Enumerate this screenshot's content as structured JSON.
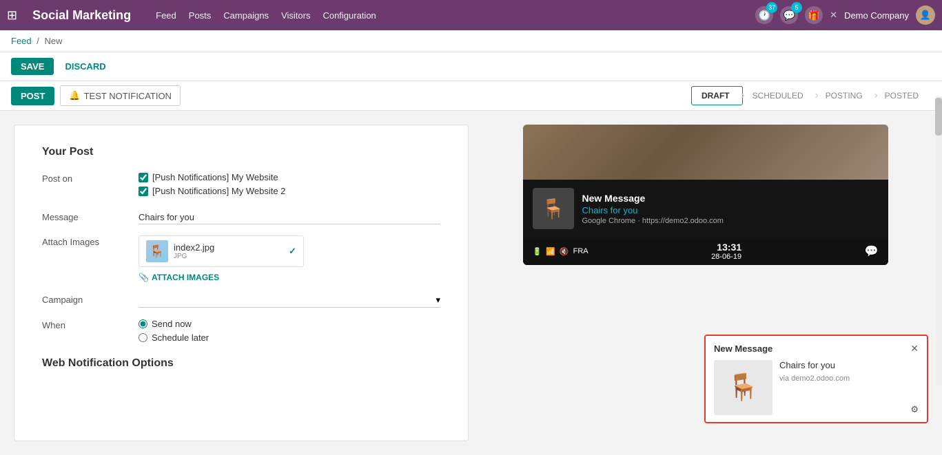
{
  "app": {
    "title": "Social Marketing",
    "nav": {
      "links": [
        "Feed",
        "Posts",
        "Campaigns",
        "Visitors",
        "Configuration"
      ]
    },
    "header_icons": {
      "clock_badge": "37",
      "chat_badge": "5",
      "gift": "🎁",
      "close": "✕",
      "company": "Demo Company"
    }
  },
  "breadcrumb": {
    "feed": "Feed",
    "separator": "/",
    "current": "New"
  },
  "toolbar": {
    "save": "SAVE",
    "discard": "DISCARD"
  },
  "action_bar": {
    "post_btn": "POST",
    "test_btn": "TEST NOTIFICATION"
  },
  "status_steps": [
    {
      "label": "DRAFT",
      "active": true
    },
    {
      "label": "SCHEDULED",
      "active": false
    },
    {
      "label": "POSTING",
      "active": false
    },
    {
      "label": "POSTED",
      "active": false
    }
  ],
  "form": {
    "section_title": "Your Post",
    "post_on_label": "Post on",
    "post_on_items": [
      "[Push Notifications] My Website",
      "[Push Notifications] My Website 2"
    ],
    "message_label": "Message",
    "message_value": "Chairs for you",
    "attach_images_label": "Attach Images",
    "image_filename": "index2.jpg",
    "image_filetype": "JPG",
    "attach_btn": "ATTACH IMAGES",
    "campaign_label": "Campaign",
    "when_label": "When",
    "when_options": [
      {
        "label": "Send now",
        "selected": true
      },
      {
        "label": "Schedule later",
        "selected": false
      }
    ],
    "web_notification_title": "Web Notification Options"
  },
  "preview": {
    "new_message": "New Message",
    "subtitle": "Chairs for you",
    "source": "Google Chrome · https://demo2.odoo.com",
    "time": "13:31",
    "date": "28-06-19",
    "status_icons": [
      "🔋",
      "📶",
      "🔇",
      "FRA"
    ]
  },
  "popup": {
    "title": "New Message",
    "message": "Chairs for you",
    "domain": "via demo2.odoo.com"
  }
}
